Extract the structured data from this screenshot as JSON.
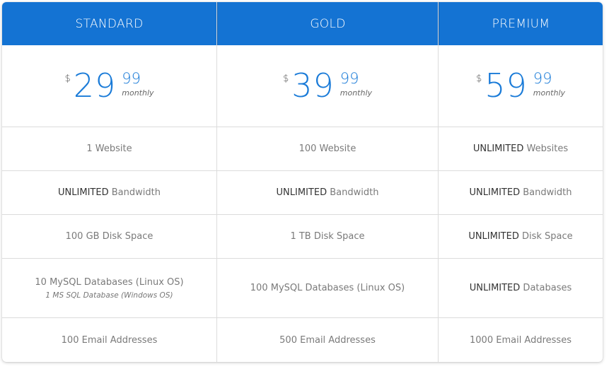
{
  "plans": [
    {
      "name": "STANDARD",
      "currency": "$",
      "price_whole": "29",
      "price_cents": "99",
      "period": "monthly",
      "features": [
        {
          "strong": "",
          "text": "1 Website",
          "note": ""
        },
        {
          "strong": "UNLIMITED",
          "text": " Bandwidth",
          "note": ""
        },
        {
          "strong": "",
          "text": "100 GB Disk Space",
          "note": ""
        },
        {
          "strong": "",
          "text": "10 MySQL Databases (Linux OS)",
          "note": "1 MS SQL Database (Windows OS)"
        },
        {
          "strong": "",
          "text": "100 Email Addresses",
          "note": ""
        }
      ]
    },
    {
      "name": "GOLD",
      "currency": "$",
      "price_whole": "39",
      "price_cents": "99",
      "period": "monthly",
      "features": [
        {
          "strong": "",
          "text": "100 Website",
          "note": ""
        },
        {
          "strong": "UNLIMITED",
          "text": " Bandwidth",
          "note": ""
        },
        {
          "strong": "",
          "text": "1 TB Disk Space",
          "note": ""
        },
        {
          "strong": "",
          "text": "100 MySQL Databases (Linux OS)",
          "note": ""
        },
        {
          "strong": "",
          "text": "500 Email Addresses",
          "note": ""
        }
      ]
    },
    {
      "name": "PREMIUM",
      "currency": "$",
      "price_whole": "59",
      "price_cents": "99",
      "period": "monthly",
      "features": [
        {
          "strong": "UNLIMITED",
          "text": " Websites",
          "note": ""
        },
        {
          "strong": "UNLIMITED",
          "text": " Bandwidth",
          "note": ""
        },
        {
          "strong": "UNLIMITED",
          "text": " Disk Space",
          "note": ""
        },
        {
          "strong": "UNLIMITED",
          "text": " Databases",
          "note": ""
        },
        {
          "strong": "",
          "text": "1000 Email Addresses",
          "note": ""
        }
      ]
    }
  ],
  "colors": {
    "header_bg": "#1473d3",
    "price_blue": "#1a7bd8",
    "feature_text": "#7a7a7a",
    "strong_text": "#333333",
    "divider": "#dcdcdc"
  }
}
